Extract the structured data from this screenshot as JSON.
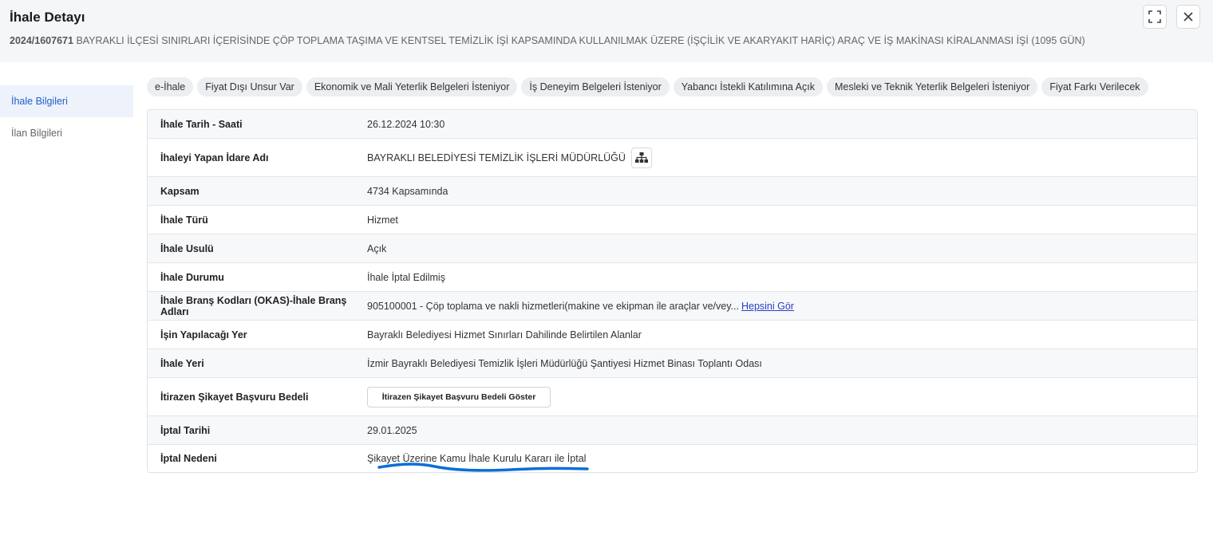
{
  "header": {
    "title": "İhale Detayı",
    "ikn": "2024/1607671",
    "tender_name": "BAYRAKLI İLÇESİ SINIRLARI İÇERİSİNDE ÇÖP TOPLAMA TAŞIMA VE KENTSEL TEMİZLİK İŞİ KAPSAMINDA KULLANILMAK ÜZERE (İŞÇİLİK VE AKARYAKIT HARİÇ) ARAÇ VE İŞ MAKİNASI KİRALANMASI İŞİ (1095 GÜN)",
    "expand_icon": "expand-icon",
    "close_icon": "close-icon"
  },
  "sidebar": {
    "items": [
      {
        "label": "İhale Bilgileri",
        "active": true
      },
      {
        "label": "İlan Bilgileri",
        "active": false
      }
    ]
  },
  "tags": [
    "e-İhale",
    "Fiyat Dışı Unsur Var",
    "Ekonomik ve Mali Yeterlik Belgeleri İsteniyor",
    "İş Deneyim Belgeleri İsteniyor",
    "Yabancı İstekli Katılımına Açık",
    "Mesleki ve Teknik Yeterlik Belgeleri İsteniyor",
    "Fiyat Farkı Verilecek"
  ],
  "details": {
    "rows": [
      {
        "label": "İhale Tarih - Saati",
        "value": "26.12.2024 10:30"
      },
      {
        "label": "İhaleyi Yapan İdare Adı",
        "value": "BAYRAKLI BELEDİYESİ TEMİZLİK İŞLERİ MÜDÜRLÜĞÜ"
      },
      {
        "label": "Kapsam",
        "value": "4734 Kapsamında"
      },
      {
        "label": "İhale Türü",
        "value": "Hizmet"
      },
      {
        "label": "İhale Usulü",
        "value": "Açık"
      },
      {
        "label": "İhale Durumu",
        "value": "İhale İptal Edilmiş"
      },
      {
        "label": "İhale Branş Kodları (OKAS)-İhale Branş Adları",
        "value": "905100001 - Çöp toplama ve nakli hizmetleri(makine ve ekipman ile araçlar ve/vey...",
        "link": "Hepsini Gör"
      },
      {
        "label": "İşin Yapılacağı Yer",
        "value": "Bayraklı Belediyesi Hizmet Sınırları Dahilinde Belirtilen Alanlar"
      },
      {
        "label": "İhale Yeri",
        "value": "İzmir Bayraklı Belediyesi Temizlik İşleri Müdürlüğü Şantiyesi Hizmet Binası Toplantı Odası"
      },
      {
        "label": "İtirazen Şikayet Başvuru Bedeli",
        "button": "İtirazen Şikayet Başvuru Bedeli Göster"
      },
      {
        "label": "İptal Tarihi",
        "value": "29.01.2025"
      },
      {
        "label": "İptal Nedeni",
        "value": "Şikayet Üzerine Kamu İhale Kurulu Kararı ile İptal"
      }
    ]
  },
  "colors": {
    "accent": "#2060c8",
    "link": "#2a3ec7",
    "annotation_stroke": "#0a6fd6"
  },
  "icons": {
    "org_chart": "sitemap-icon"
  }
}
